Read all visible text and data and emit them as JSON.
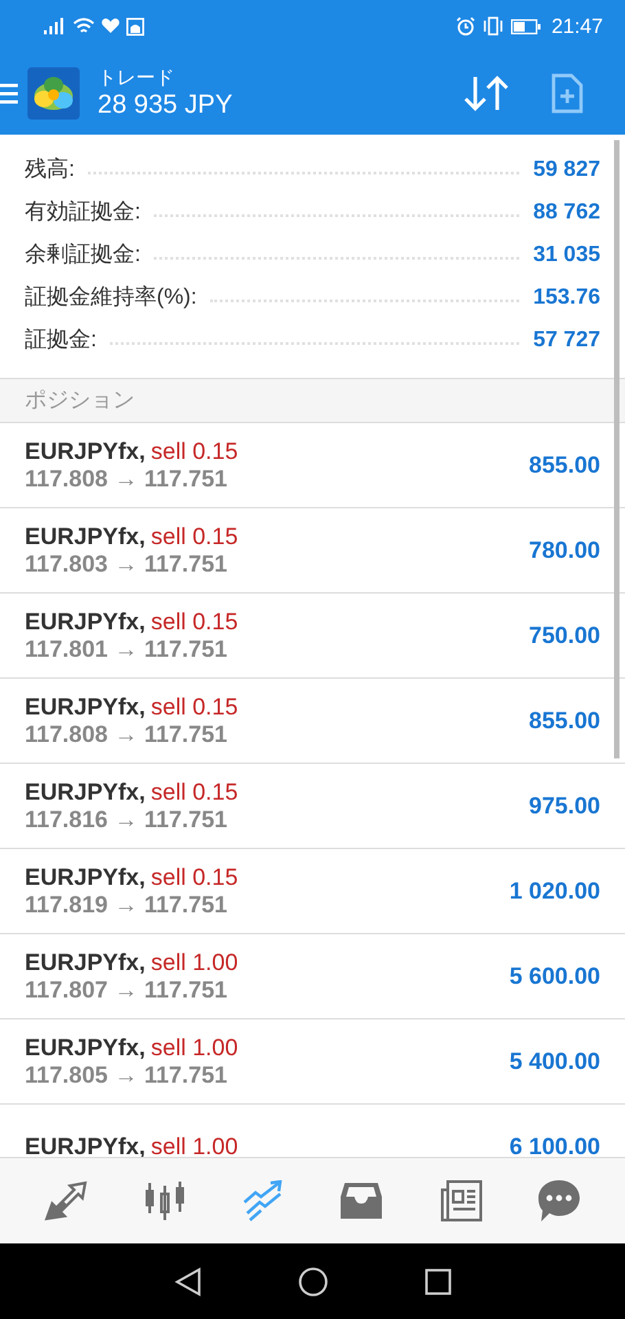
{
  "status_bar": {
    "time": "21:47"
  },
  "header": {
    "title": "トレード",
    "balance": "28 935 JPY"
  },
  "summary": [
    {
      "label": "残高:",
      "value": "59 827"
    },
    {
      "label": "有効証拠金:",
      "value": "88 762"
    },
    {
      "label": "余剰証拠金:",
      "value": "31 035"
    },
    {
      "label": "証拠金維持率(%):",
      "value": "153.76"
    },
    {
      "label": "証拠金:",
      "value": "57 727"
    }
  ],
  "section": {
    "title": "ポジション"
  },
  "positions": [
    {
      "symbol": "EURJPYfx,",
      "order": "sell 0.15",
      "prices": "117.808 → 117.751",
      "profit": "855.00"
    },
    {
      "symbol": "EURJPYfx,",
      "order": "sell 0.15",
      "prices": "117.803 → 117.751",
      "profit": "780.00"
    },
    {
      "symbol": "EURJPYfx,",
      "order": "sell 0.15",
      "prices": "117.801 → 117.751",
      "profit": "750.00"
    },
    {
      "symbol": "EURJPYfx,",
      "order": "sell 0.15",
      "prices": "117.808 → 117.751",
      "profit": "855.00"
    },
    {
      "symbol": "EURJPYfx,",
      "order": "sell 0.15",
      "prices": "117.816 → 117.751",
      "profit": "975.00"
    },
    {
      "symbol": "EURJPYfx,",
      "order": "sell 0.15",
      "prices": "117.819 → 117.751",
      "profit": "1 020.00"
    },
    {
      "symbol": "EURJPYfx,",
      "order": "sell 1.00",
      "prices": "117.807 → 117.751",
      "profit": "5 600.00"
    },
    {
      "symbol": "EURJPYfx,",
      "order": "sell 1.00",
      "prices": "117.805 → 117.751",
      "profit": "5 400.00"
    },
    {
      "symbol": "EURJPYfx,",
      "order": "sell 1.00",
      "profit": "6 100.00"
    }
  ],
  "bottom_nav": [
    {
      "kind": "quotes",
      "selected": false
    },
    {
      "kind": "chart",
      "selected": false
    },
    {
      "kind": "trade",
      "selected": true
    },
    {
      "kind": "history",
      "selected": false
    },
    {
      "kind": "news",
      "selected": false
    },
    {
      "kind": "chat",
      "selected": false
    }
  ]
}
